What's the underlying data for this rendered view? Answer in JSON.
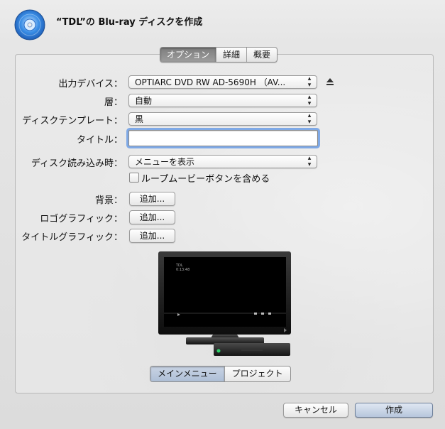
{
  "window": {
    "title": "“TDL”の Blu-ray ディスクを作成"
  },
  "tabs": [
    {
      "label": "オプション",
      "active": true
    },
    {
      "label": "詳細",
      "active": false
    },
    {
      "label": "概要",
      "active": false
    }
  ],
  "fields": {
    "output_device": {
      "label": "出力デバイス：",
      "value": "OPTIARC DVD RW AD-5690H （AV..."
    },
    "layer": {
      "label": "層：",
      "value": "自動"
    },
    "disc_template": {
      "label": "ディスクテンプレート：",
      "value": "黒"
    },
    "title": {
      "label": "タイトル：",
      "value": ""
    },
    "on_disc_load": {
      "label": "ディスク読み込み時：",
      "value": "メニューを表示"
    },
    "loop_checkbox": {
      "label": "ループムービーボタンを含める",
      "checked": false
    },
    "background": {
      "label": "背景：",
      "button": "追加..."
    },
    "logo_graphic": {
      "label": "ロゴグラフィック：",
      "button": "追加..."
    },
    "title_graphic": {
      "label": "タイトルグラフィック：",
      "button": "追加..."
    }
  },
  "preview": {
    "screen_text_line1": "TDL",
    "screen_text_line2": "0:13:48"
  },
  "segments": [
    {
      "label": "メインメニュー",
      "active": true
    },
    {
      "label": "プロジェクト",
      "active": false
    }
  ],
  "buttons": {
    "cancel": "キャンセル",
    "create": "作成"
  },
  "icons": {
    "app": "bluray-disc-icon",
    "eject": "eject-icon",
    "popup_arrows": "updown-arrows-icon"
  }
}
